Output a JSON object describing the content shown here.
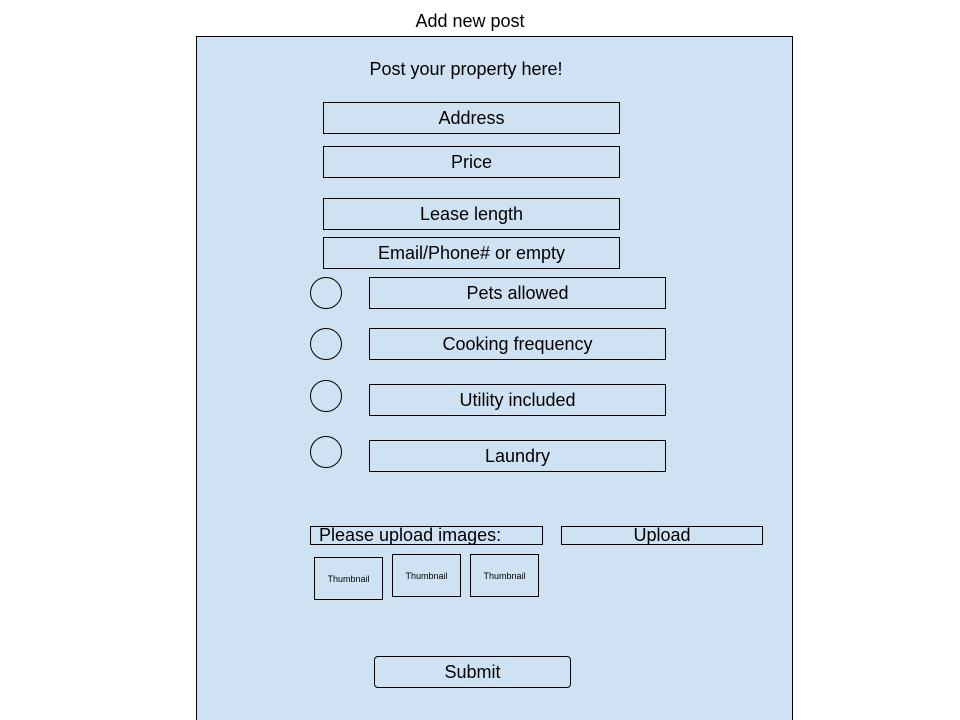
{
  "page": {
    "title": "Add new post"
  },
  "form": {
    "heading": "Post your property here!",
    "address": {
      "placeholder": "Address",
      "value": ""
    },
    "price": {
      "placeholder": "Price",
      "value": ""
    },
    "lease_length": {
      "placeholder": "Lease length",
      "value": ""
    },
    "contact": {
      "placeholder": "Email/Phone# or empty",
      "value": ""
    },
    "options": [
      {
        "label": "Pets allowed",
        "selected": false
      },
      {
        "label": "Cooking frequency",
        "selected": false
      },
      {
        "label": "Utility included",
        "selected": false
      },
      {
        "label": "Laundry",
        "selected": false
      }
    ],
    "upload_prompt": "Please upload images:",
    "upload_label": "Upload",
    "thumbnails": [
      "Thumbnail",
      "Thumbnail",
      "Thumbnail"
    ],
    "submit_label": "Submit"
  },
  "colors": {
    "panel_background": "#cfe2f3",
    "border": "#000000"
  }
}
